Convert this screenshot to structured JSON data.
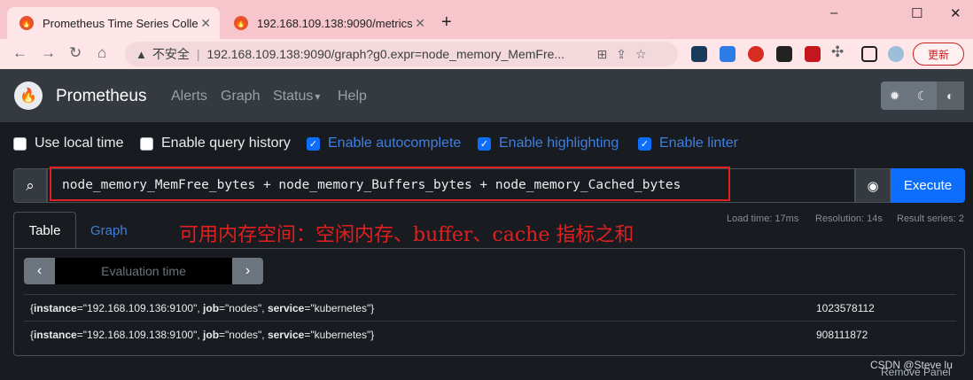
{
  "browser": {
    "tabs": [
      {
        "title": "Prometheus Time Series Collec",
        "active": true
      },
      {
        "title": "192.168.109.138:9090/metrics",
        "active": false
      }
    ],
    "new_tab": "+",
    "window_controls": {
      "minimize": "–",
      "maximize": "☐",
      "close": "✕"
    },
    "insecure_label": "不安全",
    "url": "192.168.109.138:9090/graph?g0.expr=node_memory_MemFre...",
    "update_label": "更新"
  },
  "navbar": {
    "brand": "Prometheus",
    "links": [
      "Alerts",
      "Graph",
      "Status",
      "Help"
    ],
    "status_caret": "▾"
  },
  "options": [
    {
      "label": "Use local time",
      "checked": false
    },
    {
      "label": "Enable query history",
      "checked": false
    },
    {
      "label": "Enable autocomplete",
      "checked": true
    },
    {
      "label": "Enable highlighting",
      "checked": true
    },
    {
      "label": "Enable linter",
      "checked": true
    }
  ],
  "expression": {
    "value": "node_memory_MemFree_bytes + node_memory_Buffers_bytes + node_memory_Cached_bytes",
    "execute_label": "Execute"
  },
  "annotation": "可用内存空间：空闲内存、buffer、cache 指标之和",
  "panel": {
    "tabs": [
      "Table",
      "Graph"
    ],
    "stats": {
      "load_time": "Load time: 17ms",
      "resolution": "Resolution: 14s",
      "result_series": "Result series: 2"
    },
    "eval_placeholder": "Evaluation time",
    "rows": [
      {
        "instance": "\"192.168.109.136:9100\"",
        "job": "\"nodes\"",
        "service": "\"kubernetes\"",
        "value": "1023578112"
      },
      {
        "instance": "\"192.168.109.138:9100\"",
        "job": "\"nodes\"",
        "service": "\"kubernetes\"",
        "value": "908111872"
      }
    ],
    "remove_label": "Remove Panel"
  },
  "watermark": "CSDN @Steve lu",
  "colors": {
    "accent": "#0d6efd",
    "annotation": "#e02020",
    "navbar": "#343a40",
    "tabstrip": "#f7c6cd"
  }
}
